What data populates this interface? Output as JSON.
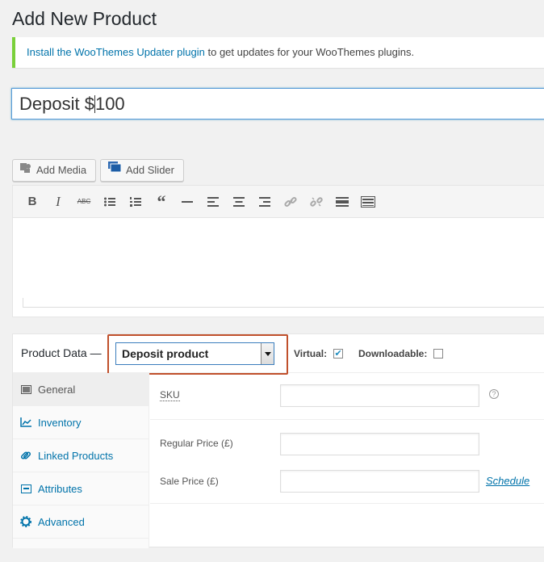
{
  "page": {
    "title": "Add New Product"
  },
  "notice": {
    "link_text": "Install the WooThemes Updater plugin",
    "rest_text": " to get updates for your WooThemes plugins.",
    "border_color": "#7ad03a"
  },
  "post_title": {
    "before_caret": "Deposit $",
    "after_caret": "100"
  },
  "media_buttons": {
    "add_media": "Add Media",
    "add_slider": "Add Slider"
  },
  "toolbar": {
    "icons": [
      "bold-icon",
      "italic-icon",
      "strikethrough-icon",
      "bullet-list-icon",
      "numbered-list-icon",
      "blockquote-icon",
      "horizontal-rule-icon",
      "align-left-icon",
      "align-center-icon",
      "align-right-icon",
      "link-icon",
      "unlink-icon",
      "read-more-icon",
      "toolbar-toggle-icon"
    ]
  },
  "product_data": {
    "label": "Product Data —",
    "type_selected": "Deposit product",
    "virtual_label": "Virtual:",
    "virtual_checked": true,
    "downloadable_label": "Downloadable:",
    "downloadable_checked": false,
    "highlight_color": "#c0502c"
  },
  "tabs": [
    {
      "label": "General",
      "icon": "general-icon",
      "active": true
    },
    {
      "label": "Inventory",
      "icon": "inventory-icon",
      "active": false
    },
    {
      "label": "Linked Products",
      "icon": "linked-products-icon",
      "active": false
    },
    {
      "label": "Attributes",
      "icon": "attributes-icon",
      "active": false
    },
    {
      "label": "Advanced",
      "icon": "advanced-icon",
      "active": false
    }
  ],
  "general": {
    "sku_label": "SKU",
    "sku_value": "",
    "regular_price_label": "Regular Price (£)",
    "regular_price_value": "",
    "sale_price_label": "Sale Price (£)",
    "sale_price_value": "",
    "schedule_link": "Schedule"
  }
}
